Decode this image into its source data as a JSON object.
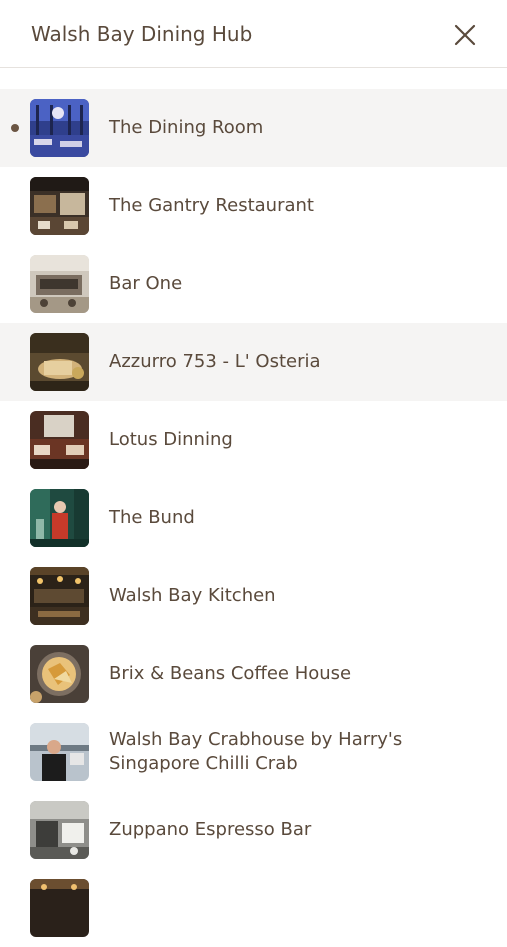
{
  "header": {
    "title": "Walsh Bay Dining Hub",
    "close_icon": "close-icon"
  },
  "restaurants": [
    {
      "name": "The Dining Room",
      "active": true
    },
    {
      "name": "The Gantry Restaurant"
    },
    {
      "name": "Bar One"
    },
    {
      "name": "Azzurro 753 - L' Osteria"
    },
    {
      "name": "Lotus Dinning"
    },
    {
      "name": "The Bund"
    },
    {
      "name": "Walsh Bay Kitchen"
    },
    {
      "name": "Brix & Beans Coffee House"
    },
    {
      "name": "Walsh Bay Crabhouse by Harry's Singapore Chilli Crab"
    },
    {
      "name": "Zuppano Espresso Bar"
    }
  ],
  "colors": {
    "text": "#5a4a3c",
    "highlight_bg": "#f5f4f3",
    "divider": "#e6e2de",
    "active_dot": "#6b5543"
  }
}
